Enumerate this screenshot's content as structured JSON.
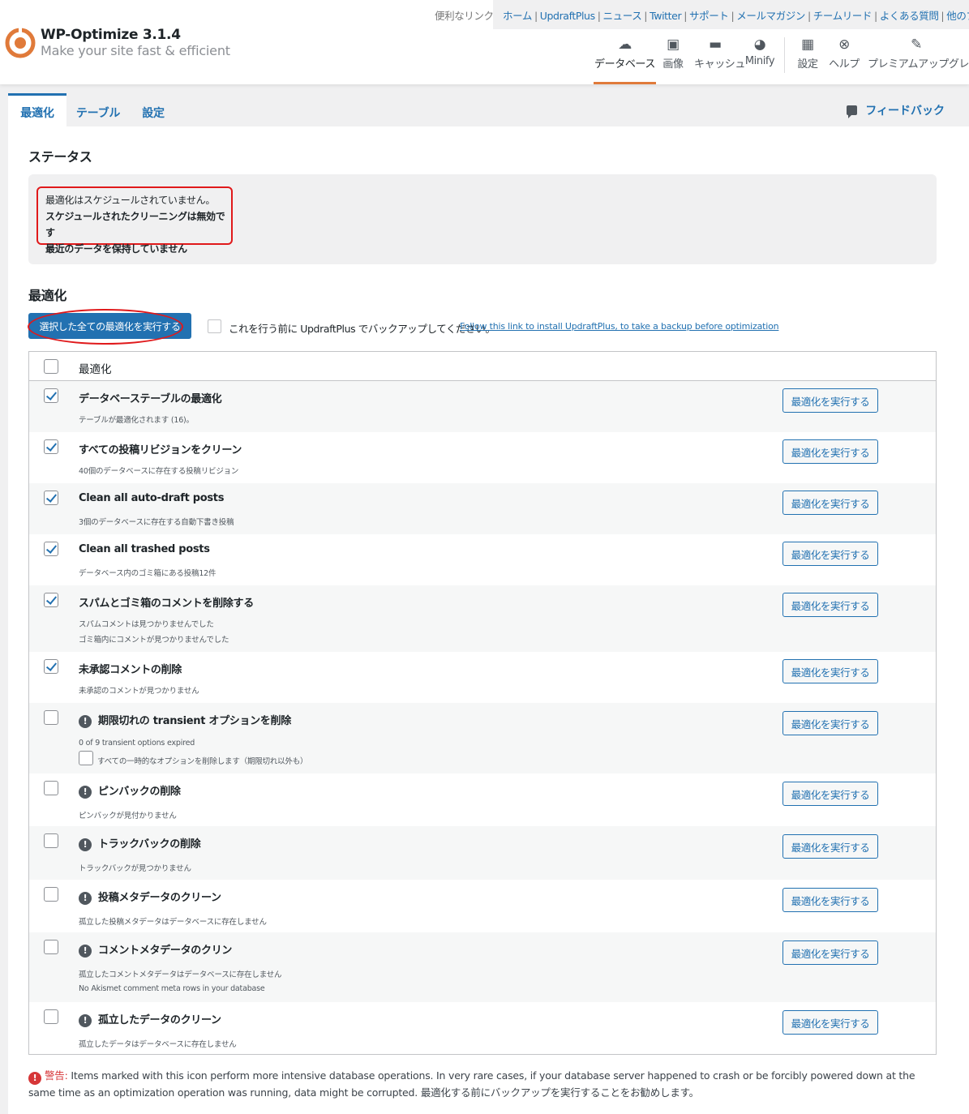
{
  "quick_links": {
    "label": "便利なリンク",
    "items": [
      "ホーム",
      "UpdraftPlus",
      "ニュース",
      "Twitter",
      "サポート",
      "メールマガジン",
      "チームリード",
      "よくある質問",
      "他のプラグイン"
    ]
  },
  "brand": {
    "title": "WP-Optimize 3.1.4",
    "subtitle": "Make your site fast & efficient",
    "accent": "#e07a3a"
  },
  "main_nav": {
    "items": [
      {
        "label": "データベース",
        "icon": "cloud-icon",
        "active": true
      },
      {
        "label": "画像",
        "icon": "images-icon",
        "active": false
      },
      {
        "label": "キャッシュ",
        "icon": "archive-icon",
        "active": false
      },
      {
        "label": "Minify",
        "icon": "dashboard-icon",
        "active": false
      },
      {
        "label": "設定",
        "icon": "settings-icon",
        "active": false
      },
      {
        "label": "ヘルプ",
        "icon": "help-icon",
        "active": false
      },
      {
        "label": "プレミアムアップグレード",
        "icon": "plugin-icon",
        "active": false
      }
    ]
  },
  "tabs": {
    "items": [
      "最適化",
      "テーブル",
      "設定"
    ],
    "active": "最適化",
    "feedback": "フィードバック"
  },
  "status": {
    "heading": "ステータス",
    "line1": "最適化はスケジュールされていません。",
    "line2": "スケジュールされたクリーニングは無効です",
    "line3": "最近のデータを保持していません"
  },
  "optimizations": {
    "heading": "最適化",
    "run_all_label": "選択した全ての最適化を実行する",
    "backup_text": "これを行う前に UpdraftPlus でバックアップしてください。",
    "backup_link": "Follow this link to install UpdraftPlus, to take a backup before optimization",
    "column_header": "最適化",
    "button_label": "最適化を実行する",
    "rows": [
      {
        "title": "データベーステーブルの最適化",
        "desc": [
          "テーブルが最適化されます (16)。"
        ],
        "checked": true,
        "warning": false
      },
      {
        "title": "すべての投稿リビジョンをクリーン",
        "desc": [
          "40個のデータベースに存在する投稿リビジョン"
        ],
        "checked": true,
        "warning": false
      },
      {
        "title": "Clean all auto-draft posts",
        "desc": [
          "3個のデータベースに存在する自動下書き投稿"
        ],
        "checked": true,
        "warning": false
      },
      {
        "title": "Clean all trashed posts",
        "desc": [
          "データベース内のゴミ箱にある投稿12件"
        ],
        "checked": true,
        "warning": false
      },
      {
        "title": "スパムとゴミ箱のコメントを削除する",
        "desc": [
          "スパムコメントは見つかりませんでした",
          "ゴミ箱内にコメントが見つかりませんでした"
        ],
        "checked": true,
        "warning": false
      },
      {
        "title": "未承認コメントの削除",
        "desc": [
          "未承認のコメントが見つかりません"
        ],
        "checked": true,
        "warning": false
      },
      {
        "title": "期限切れの transient オプションを削除",
        "desc": [
          "0 of 9 transient options expired"
        ],
        "sub_option": "すべての一時的なオプションを削除します（期限切れ以外も）",
        "checked": false,
        "warning": true
      },
      {
        "title": "ピンバックの削除",
        "desc": [
          "ピンバックが見付かりません"
        ],
        "checked": false,
        "warning": true
      },
      {
        "title": "トラックバックの削除",
        "desc": [
          "トラックバックが見つかりません"
        ],
        "checked": false,
        "warning": true
      },
      {
        "title": "投稿メタデータのクリーン",
        "desc": [
          "孤立した投稿メタデータはデータベースに存在しません"
        ],
        "checked": false,
        "warning": true
      },
      {
        "title": "コメントメタデータのクリン",
        "desc": [
          "孤立したコメントメタデータはデータベースに存在しません",
          "No Akismet comment meta rows in your database"
        ],
        "checked": false,
        "warning": true
      },
      {
        "title": "孤立したデータのクリーン",
        "desc": [
          "孤立したデータはデータベースに存在しません"
        ],
        "checked": false,
        "warning": true
      }
    ]
  },
  "footer_warning": {
    "label": "警告:",
    "text": " Items marked with this icon perform more intensive database operations. In very rare cases, if your database server happened to crash or be forcibly powered down at the same time as an optimization operation was running, data might be corrupted. 最適化する前にバックアップを実行することをお勧めします。"
  }
}
